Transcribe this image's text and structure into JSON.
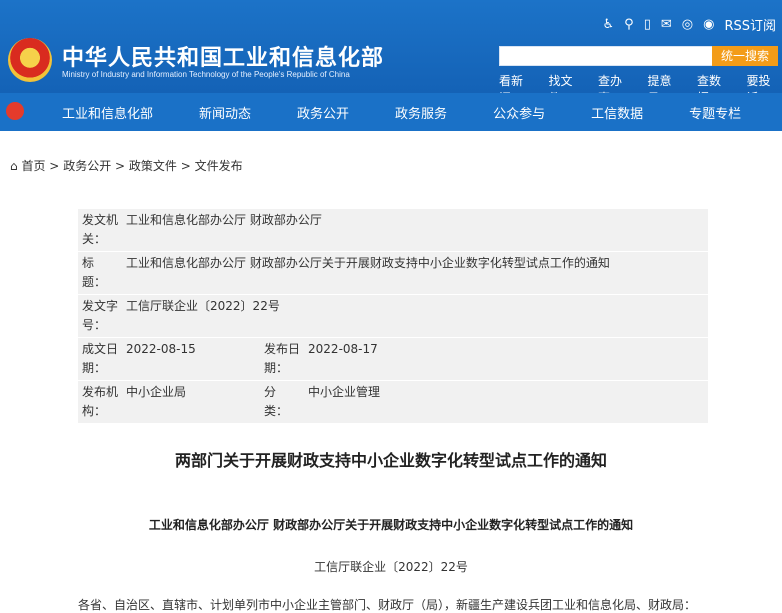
{
  "header": {
    "site_title": "中华人民共和国工业和信息化部",
    "site_sub": "Ministry of Industry and Information Technology of the People's Republic of China",
    "rss": "RSS订阅",
    "search_button": "统一搜索",
    "quick_links": [
      "看新闻",
      "找文件",
      "查办事",
      "提意见",
      "查数据",
      "要投诉"
    ]
  },
  "nav": {
    "items": [
      "工业和信息化部",
      "新闻动态",
      "政务公开",
      "政务服务",
      "公众参与",
      "工信数据",
      "专题专栏"
    ]
  },
  "breadcrumb": {
    "items": [
      "首页",
      "政务公开",
      "政策文件",
      "文件发布"
    ],
    "sep": ">"
  },
  "meta": {
    "issuer_label": "发文机关：",
    "issuer": "工业和信息化部办公厅 财政部办公厅",
    "title_label": "标　　题：",
    "title": "工业和信息化部办公厅 财政部办公厅关于开展财政支持中小企业数字化转型试点工作的通知",
    "docno_label": "发文字号：",
    "docno": "工信厅联企业〔2022〕22号",
    "date_label": "成文日期：",
    "date": "2022-08-15",
    "pub_label": "发布日期：",
    "pub": "2022-08-17",
    "org_label": "发布机构：",
    "org": "中小企业局",
    "cat_label": "分　　类：",
    "cat": "中小企业管理"
  },
  "doc": {
    "title": "两部门关于开展财政支持中小企业数字化转型试点工作的通知",
    "subtitle": "工业和信息化部办公厅 财政部办公厅关于开展财政支持中小企业数字化转型试点工作的通知",
    "number": "工信厅联企业〔2022〕22号",
    "first_line": "各省、自治区、直辖市、计划单列市中小企业主管部门、财政厅（局），新疆生产建设兵团工业和信息化局、财政局："
  }
}
